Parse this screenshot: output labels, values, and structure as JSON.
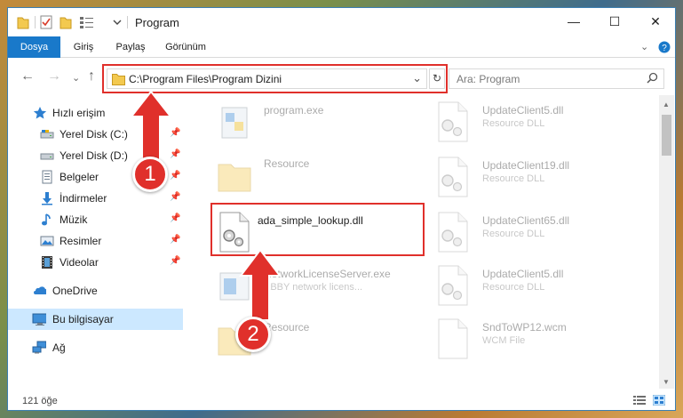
{
  "window": {
    "title": "Program",
    "controls": {
      "minimize": "—",
      "maximize": "☐",
      "close": "✕"
    }
  },
  "ribbon": {
    "tabs": [
      "Dosya",
      "Giriş",
      "Paylaş",
      "Görünüm"
    ],
    "expand_glyph": "⌄",
    "help_glyph": "?"
  },
  "address": {
    "path": "C:\\Program Files\\Program Dizini",
    "dropdown_glyph": "⌄",
    "refresh_glyph": "↻",
    "search_placeholder": "Ara: Program",
    "nav": {
      "back": "←",
      "forward": "→",
      "recent": "⌄",
      "up": "↑"
    }
  },
  "nav_pane": {
    "quick_access": "Hızlı erişim",
    "items": [
      {
        "label": "Yerel Disk (C:)",
        "icon": "drive-icon",
        "pinned": true
      },
      {
        "label": "Yerel Disk (D:)",
        "icon": "drive-icon",
        "pinned": true
      },
      {
        "label": "Belgeler",
        "icon": "documents-icon",
        "pinned": true
      },
      {
        "label": "İndirmeler",
        "icon": "download-icon",
        "pinned": true
      },
      {
        "label": "Müzik",
        "icon": "music-icon",
        "pinned": true
      },
      {
        "label": "Resimler",
        "icon": "pictures-icon",
        "pinned": true
      },
      {
        "label": "Videolar",
        "icon": "videos-icon",
        "pinned": true
      }
    ],
    "onedrive": "OneDrive",
    "this_pc": "Bu bilgisayar",
    "network": "Ağ",
    "pin_glyph": "📌"
  },
  "files": {
    "left": [
      {
        "name": "program.exe",
        "type": "",
        "icon": "exe-icon",
        "faded": true
      },
      {
        "name": "Resource",
        "type": "",
        "icon": "folder-icon",
        "faded": true
      },
      {
        "name": "ada_simple_lookup.dll",
        "type": "",
        "icon": "dll-icon",
        "faded": false
      },
      {
        "name": "NetworkLicenseServer.exe",
        "type": "ABBY network licens...",
        "icon": "exe-icon",
        "faded": true
      },
      {
        "name": "Resource",
        "type": "",
        "icon": "folder-icon",
        "faded": true
      }
    ],
    "right": [
      {
        "name": "UpdateClient5.dll",
        "type": "Resource DLL",
        "icon": "dll-icon",
        "faded": true
      },
      {
        "name": "UpdateClient19.dll",
        "type": "Resource DLL",
        "icon": "dll-icon",
        "faded": true
      },
      {
        "name": "UpdateClient65.dll",
        "type": "Resource DLL",
        "icon": "dll-icon",
        "faded": true
      },
      {
        "name": "UpdateClient5.dll",
        "type": "Resource DLL",
        "icon": "dll-icon",
        "faded": true
      },
      {
        "name": "SndToWP12.wcm",
        "type": "WCM File",
        "icon": "file-icon",
        "faded": true
      }
    ]
  },
  "status": {
    "item_count": "121 öğe"
  },
  "callouts": [
    {
      "number": "1"
    },
    {
      "number": "2"
    }
  ],
  "colors": {
    "accent": "#1979ca",
    "highlight": "#e0302b",
    "selected": "#cce8ff"
  }
}
